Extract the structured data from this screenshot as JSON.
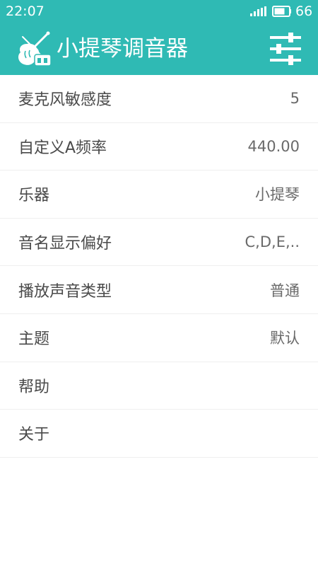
{
  "status_bar": {
    "time": "22:07",
    "battery_level": "66",
    "icons": [
      "signal-icon",
      "battery-icon"
    ]
  },
  "app_bar": {
    "title": "小提琴调音器",
    "icons": [
      "violin-icon",
      "sliders-icon"
    ]
  },
  "settings": [
    {
      "label": "麦克风敏感度",
      "value": "5"
    },
    {
      "label": "自定义A频率",
      "value": "440.00"
    },
    {
      "label": "乐器",
      "value": "小提琴"
    },
    {
      "label": "音名显示偏好",
      "value": "C,D,E,.."
    },
    {
      "label": "播放声音类型",
      "value": "普通"
    },
    {
      "label": "主题",
      "value": "默认"
    },
    {
      "label": "帮助",
      "value": ""
    },
    {
      "label": "关于",
      "value": ""
    }
  ],
  "colors": {
    "header": "#2fbab4",
    "label_text": "#4a4a4a",
    "value_text": "#6a6a6a",
    "divider": "#efefef",
    "background": "#ffffff"
  }
}
